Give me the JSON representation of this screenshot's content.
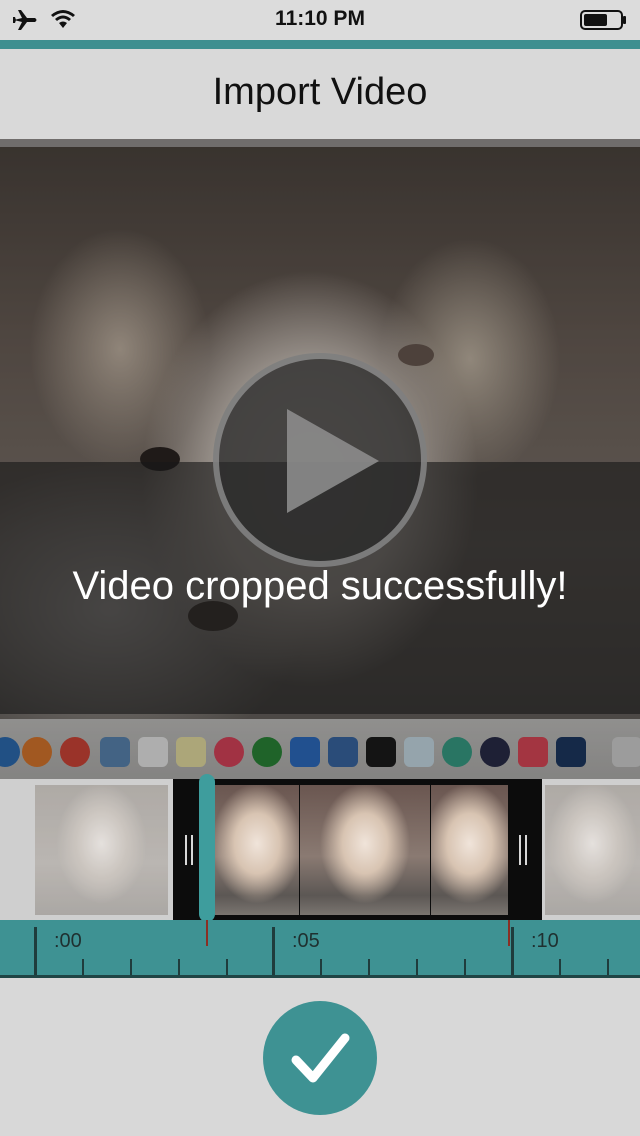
{
  "status_bar": {
    "time": "11:10 PM",
    "icons": [
      "airplane-icon",
      "wifi-icon",
      "battery-icon"
    ]
  },
  "header": {
    "title": "Import Video"
  },
  "video": {
    "play_icon": "play-icon",
    "toast_message": "Video cropped successfully!"
  },
  "timeline": {
    "labels": [
      ":00",
      ":05",
      ":10"
    ]
  },
  "actions": {
    "confirm_icon": "checkmark-icon"
  },
  "colors": {
    "accent": "#3e9293",
    "accent_dark": "#1f4545",
    "toast_bg": "#191919"
  }
}
